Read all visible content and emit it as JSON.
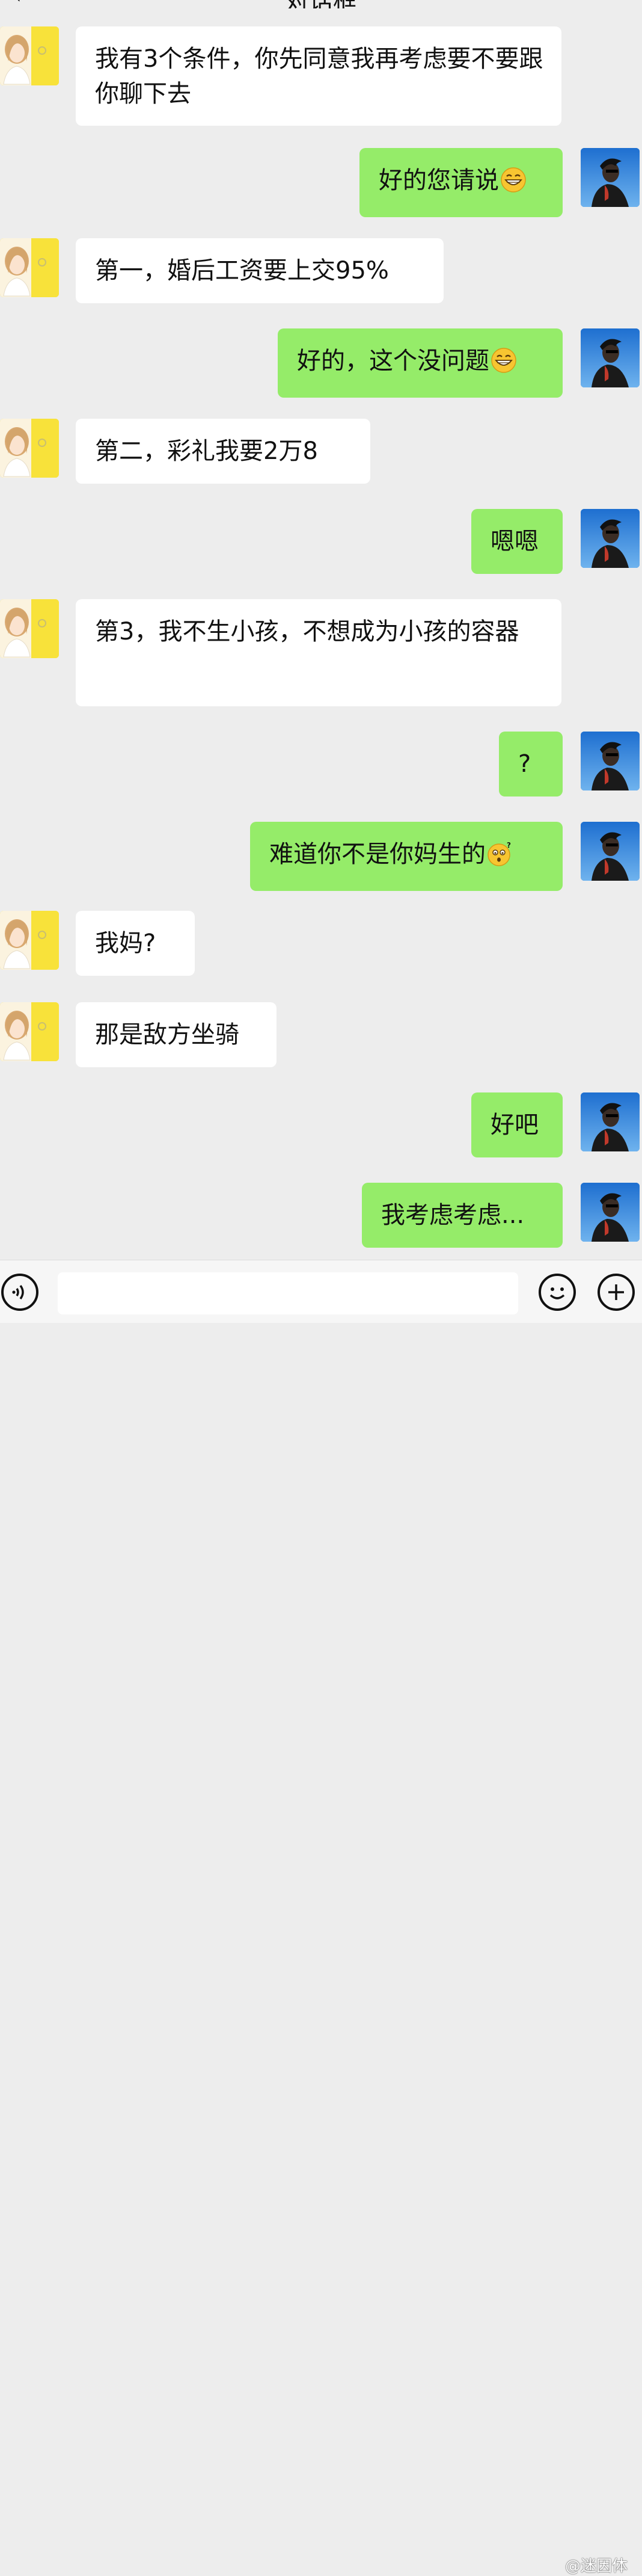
{
  "header": {
    "back_icon": "chevron-left-icon",
    "title": "对话框"
  },
  "messages": [
    {
      "side": "left",
      "text": "我有3个条件，你先同意我再考虑要不要跟你聊下去",
      "emoji": ""
    },
    {
      "side": "right",
      "text": "好的您请说",
      "emoji": "grin"
    },
    {
      "side": "left",
      "text": "第一，婚后工资要上交95%",
      "emoji": ""
    },
    {
      "side": "right",
      "text": "好的，这个没问题",
      "emoji": "grin"
    },
    {
      "side": "left",
      "text": "第二，彩礼我要2万8",
      "emoji": ""
    },
    {
      "side": "right",
      "text": "嗯嗯",
      "emoji": ""
    },
    {
      "side": "left",
      "text": "第3，我不生小孩，不想成为小孩的容器",
      "emoji": ""
    },
    {
      "side": "right",
      "text": "?",
      "emoji": ""
    },
    {
      "side": "right",
      "text": "难道你不是你妈生的",
      "emoji": "puzzled"
    },
    {
      "side": "left",
      "text": "我妈?",
      "emoji": ""
    },
    {
      "side": "left",
      "text": "那是敌方坐骑",
      "emoji": ""
    },
    {
      "side": "right",
      "text": "好吧",
      "emoji": ""
    },
    {
      "side": "right",
      "text": "我考虑考虑...",
      "emoji": ""
    }
  ],
  "input_bar": {
    "voice_icon": "voice-icon",
    "emoji_icon": "emoji-icon",
    "plus_icon": "plus-icon",
    "input_value": ""
  },
  "watermark": "@迷因体"
}
